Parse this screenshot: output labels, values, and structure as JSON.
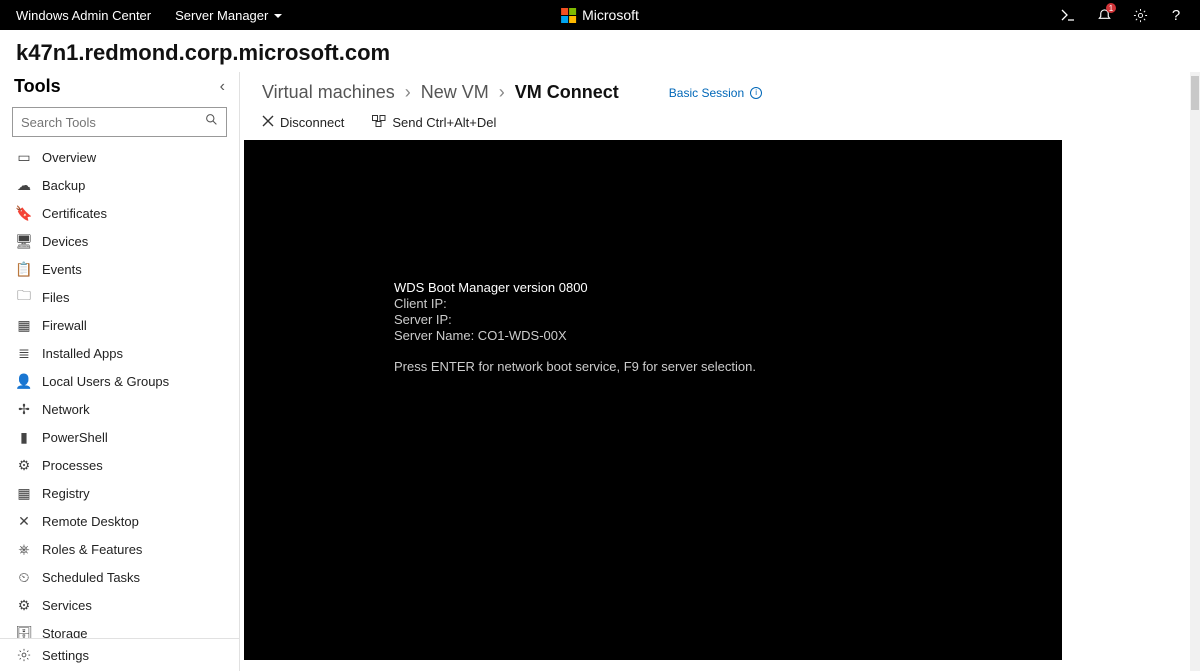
{
  "topbar": {
    "app_name": "Windows Admin Center",
    "menu_label": "Server Manager",
    "brand": "Microsoft",
    "notif_count": "1"
  },
  "server_name": "k47n1.redmond.corp.microsoft.com",
  "sidebar": {
    "title": "Tools",
    "search_placeholder": "Search Tools",
    "items": [
      {
        "icon": "▭",
        "label": "Overview"
      },
      {
        "icon": "☁",
        "label": "Backup"
      },
      {
        "icon": "🔖",
        "label": "Certificates"
      },
      {
        "icon": "🖥",
        "label": "Devices"
      },
      {
        "icon": "📋",
        "label": "Events"
      },
      {
        "icon": "🗀",
        "label": "Files"
      },
      {
        "icon": "▦",
        "label": "Firewall"
      },
      {
        "icon": "≣",
        "label": "Installed Apps"
      },
      {
        "icon": "👤",
        "label": "Local Users & Groups"
      },
      {
        "icon": "✢",
        "label": "Network"
      },
      {
        "icon": "▮",
        "label": "PowerShell"
      },
      {
        "icon": "⚙",
        "label": "Processes"
      },
      {
        "icon": "▦",
        "label": "Registry"
      },
      {
        "icon": "✕",
        "label": "Remote Desktop"
      },
      {
        "icon": "⎈",
        "label": "Roles & Features"
      },
      {
        "icon": "⏲",
        "label": "Scheduled Tasks"
      },
      {
        "icon": "⚙",
        "label": "Services"
      },
      {
        "icon": "🗄",
        "label": "Storage"
      }
    ],
    "settings_label": "Settings"
  },
  "breadcrumb": {
    "level1": "Virtual machines",
    "level2": "New VM",
    "level3": "VM Connect",
    "basic_session": "Basic Session"
  },
  "vm_toolbar": {
    "disconnect": "Disconnect",
    "send_cad": "Send Ctrl+Alt+Del"
  },
  "console": {
    "line1": "WDS Boot Manager version 0800",
    "line2": "Client IP: ",
    "line3": "Server IP: ",
    "line4": "Server Name: CO1-WDS-00X",
    "line5": "Press ENTER for network boot service, F9 for server selection."
  }
}
